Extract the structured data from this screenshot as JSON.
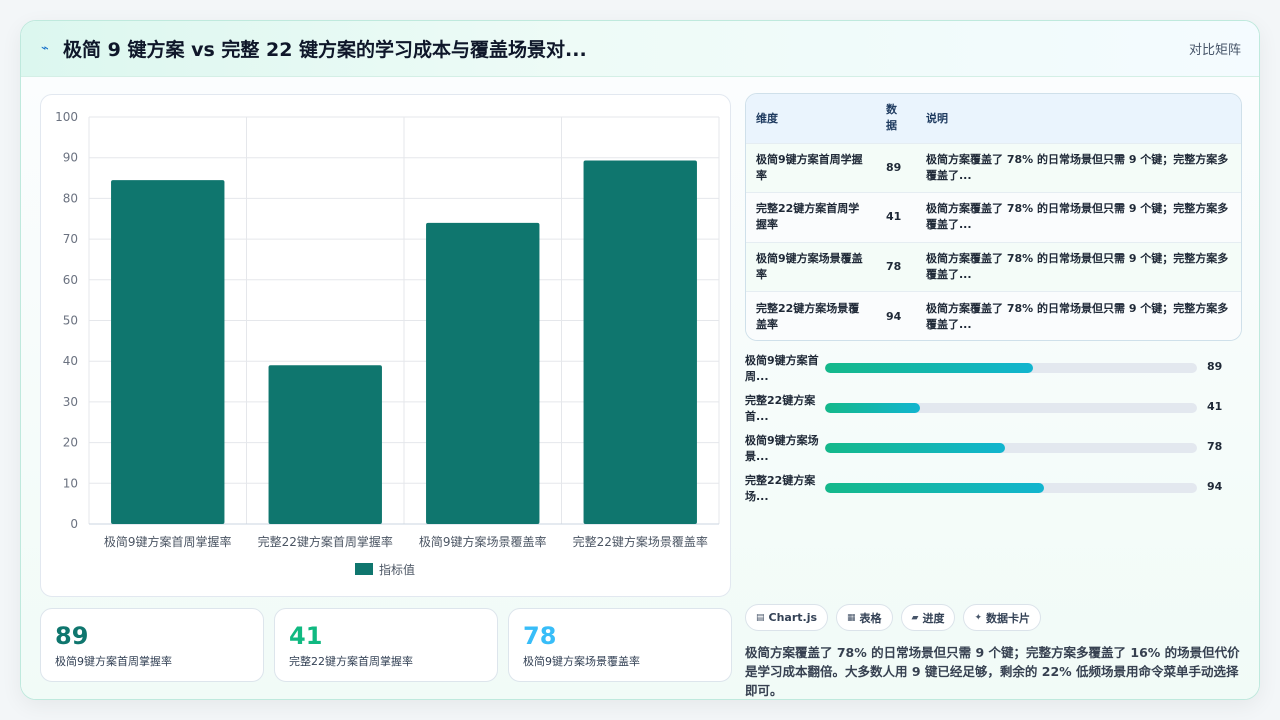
{
  "header": {
    "icon": "chart-spark-icon",
    "title": "极简 9 键方案 vs 完整 22 键方案的学习成本与覆盖场景对...",
    "tag": "对比矩阵"
  },
  "chart_data": {
    "type": "bar",
    "categories": [
      "极简9键方案首周掌握率",
      "完整22键方案首周掌握率",
      "极简9键方案场景覆盖率",
      "完整22键方案场景覆盖率"
    ],
    "series": [
      {
        "name": "指标值",
        "values": [
          84.5,
          39,
          74,
          89.3
        ],
        "color": "#0f766e"
      }
    ],
    "ylim": [
      0,
      100
    ],
    "yticks": [
      0,
      10,
      20,
      30,
      40,
      50,
      60,
      70,
      80,
      90,
      100
    ],
    "grid": true,
    "legend": "bottom"
  },
  "kpis": [
    {
      "value": "89",
      "label": "极简9键方案首周掌握率",
      "color": "#0f766e"
    },
    {
      "value": "41",
      "label": "完整22键方案首周掌握率",
      "color": "#10b981"
    },
    {
      "value": "78",
      "label": "极简9键方案场景覆盖率",
      "color": "#38bdf8"
    }
  ],
  "table": {
    "headers": {
      "dim": "维度",
      "val": "数据",
      "desc": "说明"
    },
    "rows": [
      {
        "dim": "极简9键方案首周学握率",
        "val": "89",
        "desc": "极简方案覆盖了 78% 的日常场景但只需 9 个键；完整方案多覆盖了..."
      },
      {
        "dim": "完整22键方案首周学握率",
        "val": "41",
        "desc": "极简方案覆盖了 78% 的日常场景但只需 9 个键；完整方案多覆盖了..."
      },
      {
        "dim": "极简9键方案场景覆盖率",
        "val": "78",
        "desc": "极简方案覆盖了 78% 的日常场景但只需 9 个键；完整方案多覆盖了..."
      },
      {
        "dim": "完整22键方案场景覆盖率",
        "val": "94",
        "desc": "极简方案覆盖了 78% 的日常场景但只需 9 个键；完整方案多覆盖了..."
      }
    ]
  },
  "progress": [
    {
      "label": "极简9键方案首周...",
      "value": "89",
      "fraction": 0.56
    },
    {
      "label": "完整22键方案首...",
      "value": "41",
      "fraction": 0.255
    },
    {
      "label": "极简9键方案场景...",
      "value": "78",
      "fraction": 0.485
    },
    {
      "label": "完整22键方案场...",
      "value": "94",
      "fraction": 0.588
    }
  ],
  "chips": [
    {
      "icon": "chart-icon",
      "label": "Chart.js"
    },
    {
      "icon": "table-icon",
      "label": "表格"
    },
    {
      "icon": "progress-icon",
      "label": "进度"
    },
    {
      "icon": "sparkle-icon",
      "label": "数据卡片"
    }
  ],
  "summary": "极简方案覆盖了 78% 的日常场景但只需 9 个键；完整方案多覆盖了 16% 的场景但代价是学习成本翻倍。大多数人用 9 键已经足够，剩余的 22% 低频场景用命令菜单手动选择即可。"
}
